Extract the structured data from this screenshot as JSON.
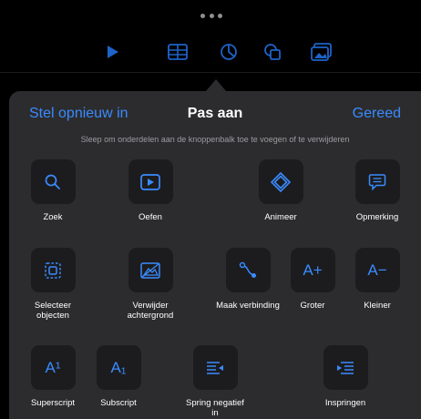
{
  "toolbar": {
    "icons": [
      "play-icon",
      "table-icon",
      "chart-icon",
      "shapes-icon",
      "media-icon"
    ],
    "accent": "#1e63c8"
  },
  "sheet": {
    "reset_label": "Stel opnieuw in",
    "title": "Pas aan",
    "done_label": "Gereed",
    "hint": "Sleep om onderdelen aan de knoppenbalk toe te voegen of te verwijderen",
    "accent": "#3a8bff"
  },
  "tools": [
    {
      "label": "Zoek",
      "icon": "search-icon"
    },
    {
      "label": "Oefen",
      "icon": "rehearse-icon"
    },
    {
      "label": "Animeer",
      "icon": "animate-icon"
    },
    {
      "label": "Opmerking",
      "icon": "comment-icon"
    },
    {
      "label": "Selecteer objecten",
      "icon": "select-objects-icon"
    },
    {
      "label": "Verwijder achtergrond",
      "icon": "remove-background-icon"
    },
    {
      "label": "Maak verbinding",
      "icon": "connection-line-icon"
    },
    {
      "label": "Groter",
      "icon": "font-bigger-icon",
      "glyph": "A+"
    },
    {
      "label": "Kleiner",
      "icon": "font-smaller-icon",
      "glyph": "A−"
    },
    {
      "label": "Superscript",
      "icon": "superscript-icon",
      "glyph": "A¹"
    },
    {
      "label": "Subscript",
      "icon": "subscript-icon",
      "glyph": "A₁"
    },
    {
      "label": "Spring negatief in",
      "icon": "outdent-icon"
    },
    {
      "label": "Inspringen",
      "icon": "indent-icon"
    }
  ]
}
